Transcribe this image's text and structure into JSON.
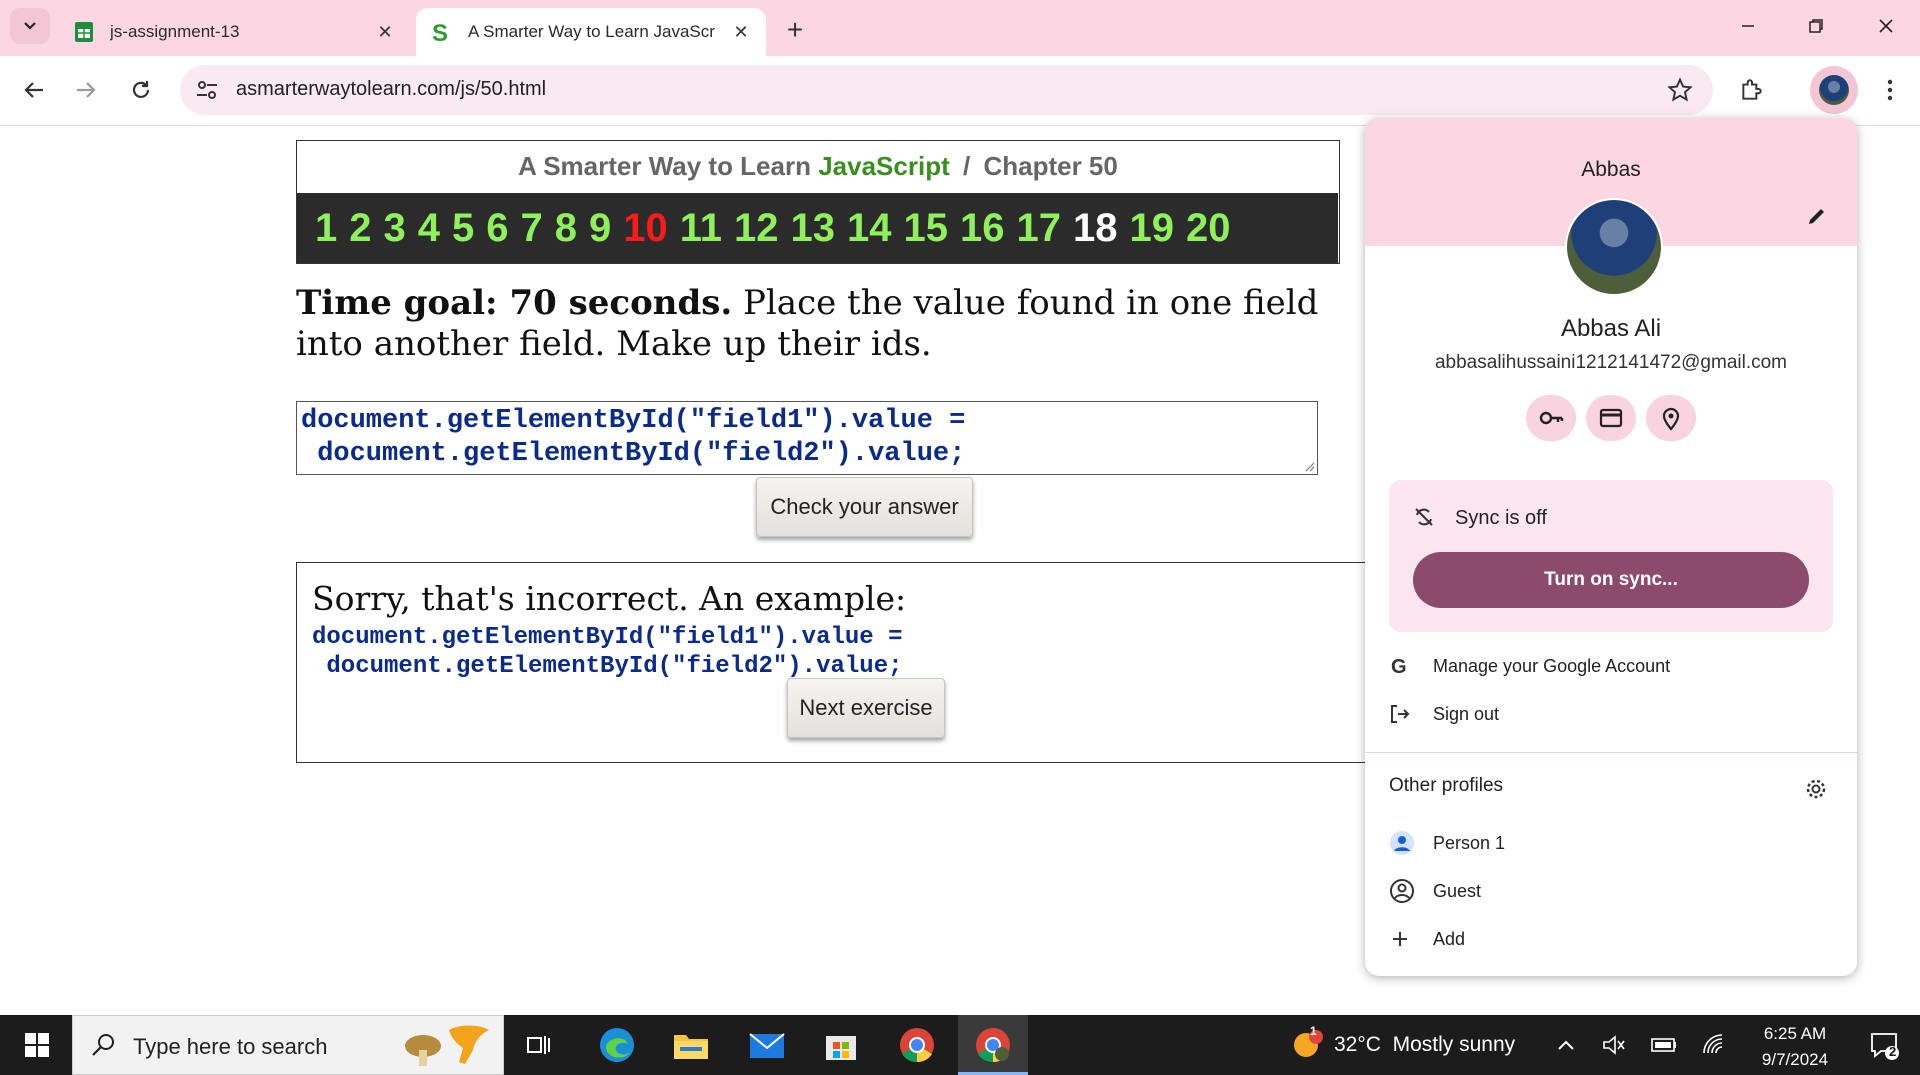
{
  "browser": {
    "tabs": [
      {
        "title": "js-assignment-13",
        "favicon": "google-sheets-icon"
      },
      {
        "title": "A Smarter Way to Learn JavaScr",
        "favicon": "smarter-way-icon"
      }
    ],
    "url": "asmarterwaytolearn.com/js/50.html"
  },
  "page": {
    "title_prefix": "A Smarter Way to Learn",
    "title_js": "JavaScript",
    "title_sep": "/",
    "title_chapter": "Chapter 50",
    "numbers": [
      "1",
      "2",
      "3",
      "4",
      "5",
      "6",
      "7",
      "8",
      "9",
      "10",
      "11",
      "12",
      "13",
      "14",
      "15",
      "16",
      "17",
      "18",
      "19",
      "20"
    ],
    "goal_bold": "Time goal: 70 seconds.",
    "goal_text": "Place the value found in one field into another field. Make up their ids.",
    "answer_line1": "document.getElementById(\"field1\").value =",
    "answer_line2": " document.getElementById(\"field2\").value;",
    "check_button": "Check your answer",
    "result_message": "Sorry, that's incorrect. An example:",
    "example_line1": "document.getElementById(\"field1\").value =",
    "example_line2": " document.getElementById(\"field2\").value;",
    "next_button": "Next exercise"
  },
  "profile": {
    "header_name": "Abbas",
    "full_name": "Abbas Ali",
    "email": "abbasalihussaini1212141472@gmail.com",
    "sync_status": "Sync is off",
    "sync_button": "Turn on sync...",
    "manage_account": "Manage your Google Account",
    "sign_out": "Sign out",
    "other_profiles_label": "Other profiles",
    "others": [
      "Person 1",
      "Guest",
      "Add"
    ]
  },
  "taskbar": {
    "search_placeholder": "Type here to search",
    "weather": "32°C  Mostly sunny",
    "weather_badge": "1",
    "time": "6:25 AM",
    "date": "9/7/2024",
    "notif_count": "2"
  }
}
